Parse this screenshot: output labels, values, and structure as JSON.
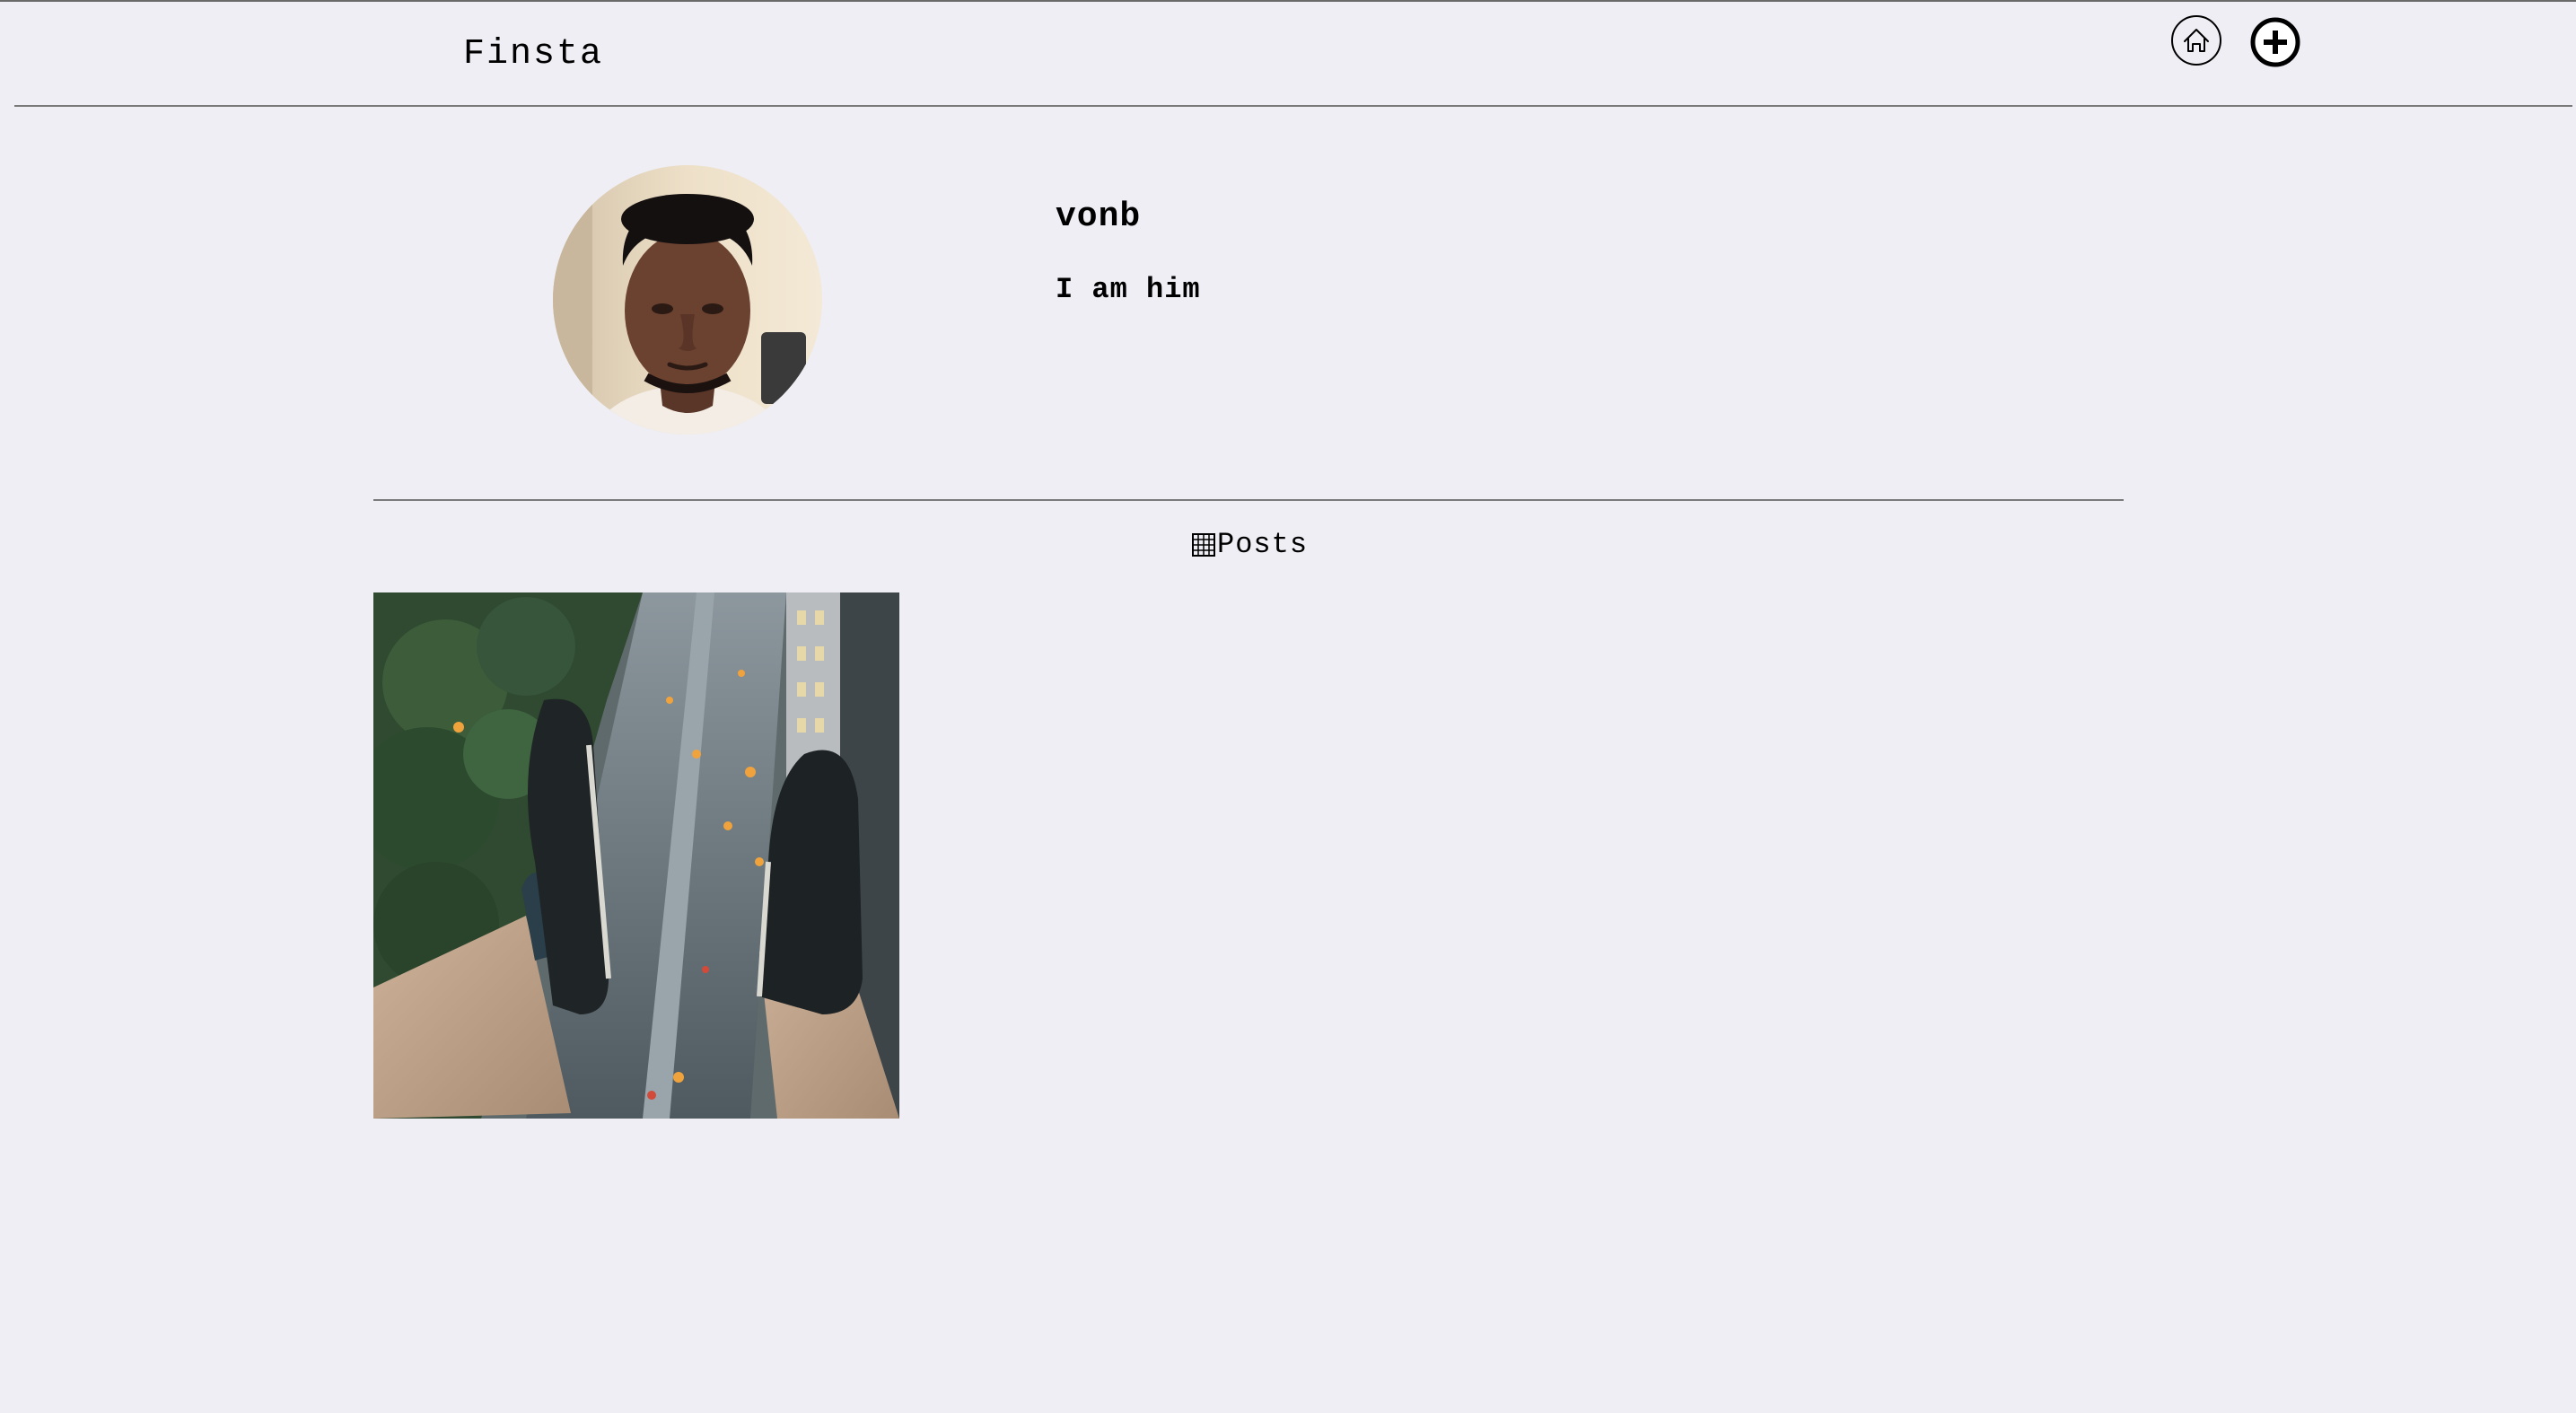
{
  "header": {
    "brand": "Finsta",
    "home_icon": "home-icon",
    "add_icon": "add-circle-icon"
  },
  "profile": {
    "username": "vonb",
    "bio": "I am him",
    "avatar": "avatar-photo"
  },
  "tabs": {
    "posts_label": "Posts",
    "posts_icon": "grid-icon"
  },
  "posts": [
    {
      "kind": "photo",
      "subject": "feet dangling over city street"
    }
  ],
  "colors": {
    "background": "#eeeef4",
    "rule": "#7a7a7a",
    "text": "#000000"
  }
}
